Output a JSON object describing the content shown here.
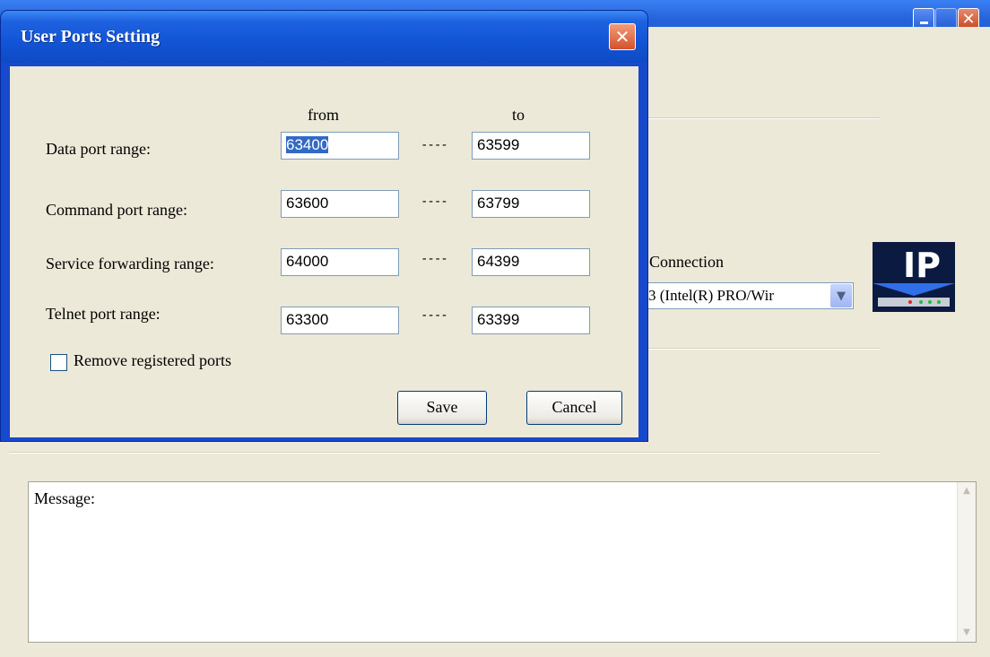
{
  "main_window": {
    "connection_label": "Connection",
    "adapter_value": "3 (Intel(R) PRO/Wir",
    "logo_text": "IP",
    "message_label": "Message:",
    "controls": {
      "minimize": "",
      "maximize": "",
      "close": "✕"
    }
  },
  "dialog": {
    "title": "User Ports Setting",
    "close_glyph": "✕",
    "col_from": "from",
    "col_to": "to",
    "separator": "----",
    "rows": [
      {
        "label": "Data port range:",
        "from": "63400",
        "to": "63599"
      },
      {
        "label": "Command port range:",
        "from": "63600",
        "to": "63799"
      },
      {
        "label": "Service forwarding range:",
        "from": "64000",
        "to": "64399"
      },
      {
        "label": "Telnet port range:",
        "from": "63300",
        "to": "63399"
      }
    ],
    "checkbox_label": "Remove registered ports",
    "checkbox_checked": false,
    "save_label": "Save",
    "cancel_label": "Cancel"
  },
  "icons": {
    "dropdown": "chevron-down-icon",
    "close": "close-icon",
    "minimize": "minimize-icon",
    "maximize": "maximize-icon",
    "logo": "ip-logo-icon"
  },
  "colors": {
    "titlebar": "#1d5bd6",
    "window_bg": "#ece9d8",
    "selection": "#316ac5",
    "close_button": "#d4512b"
  }
}
